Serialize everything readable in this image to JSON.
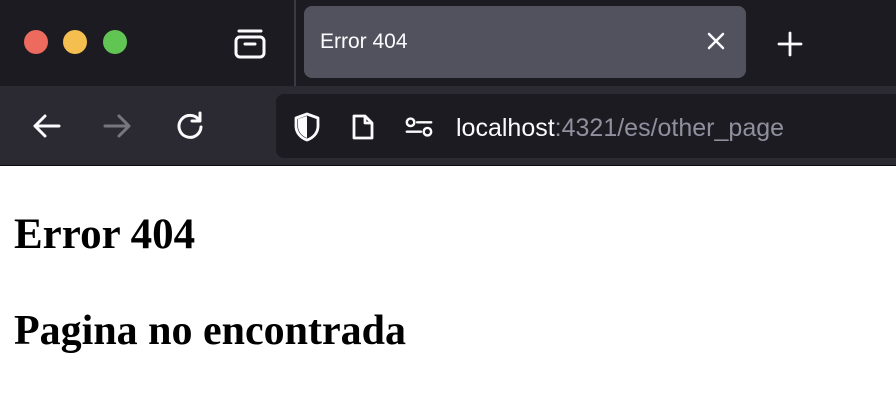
{
  "window": {
    "traffic_lights": [
      "#ec6a5e",
      "#f4bf4f",
      "#61c554"
    ]
  },
  "tabbar": {
    "tab_list_icon": "tab-list-icon",
    "active_tab": {
      "title": "Error 404",
      "close_icon": "close-icon"
    },
    "new_tab_icon": "plus-icon"
  },
  "navbar": {
    "back_icon": "arrow-left-icon",
    "forward_icon": "arrow-right-icon",
    "reload_icon": "reload-icon",
    "url": {
      "host": "localhost",
      "rest": ":4321/es/other_page"
    },
    "url_icons": [
      "shield-icon",
      "page-icon",
      "permissions-icon"
    ]
  },
  "page": {
    "heading": "Error 404",
    "subheading": "Pagina no encontrada"
  },
  "colors": {
    "tabbar_bg": "#1c1b22",
    "navbar_bg": "#2b2a33",
    "active_tab_bg": "#52525e",
    "url_dim": "#8f8f9d"
  }
}
